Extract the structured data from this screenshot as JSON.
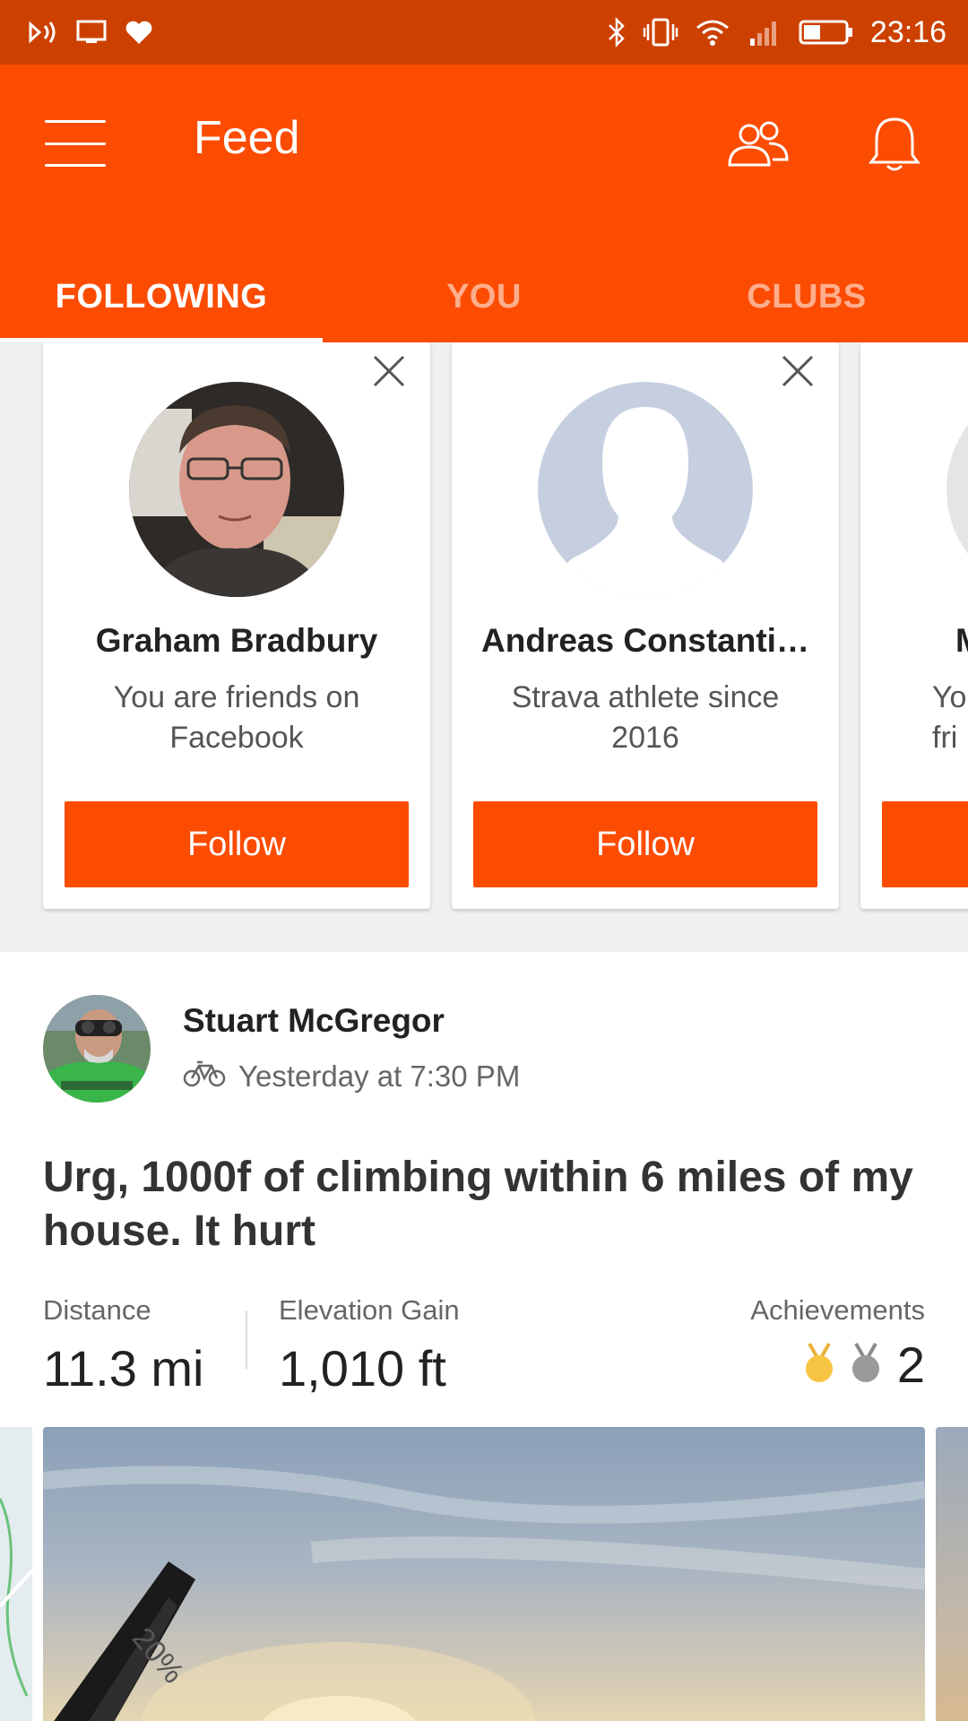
{
  "status_bar": {
    "time": "23:16"
  },
  "header": {
    "title": "Feed"
  },
  "tabs": [
    {
      "label": "FOLLOWING",
      "active": true
    },
    {
      "label": "YOU",
      "active": false
    },
    {
      "label": "CLUBS",
      "active": false
    }
  ],
  "suggestions": [
    {
      "name": "Graham Bradbury",
      "subtitle": "You are friends on Facebook",
      "button": "Follow"
    },
    {
      "name": "Andreas Constanti…",
      "subtitle": "Strava athlete since 2016",
      "button": "Follow"
    },
    {
      "name": "M",
      "subtitle": "Yo fri",
      "button": ""
    }
  ],
  "activity": {
    "athlete": "Stuart McGregor",
    "time": "Yesterday at 7:30 PM",
    "title": "Urg, 1000f of climbing within 6 miles of my house. It hurt",
    "stats": {
      "distance_label": "Distance",
      "distance_value": "11.3 mi",
      "elevation_label": "Elevation Gain",
      "elevation_value": "1,010 ft",
      "achievements_label": "Achievements",
      "achievements_value": "2"
    },
    "sign_text": "20%"
  },
  "colors": {
    "brand": "#fc4c02",
    "status_bar": "#cc4000"
  }
}
